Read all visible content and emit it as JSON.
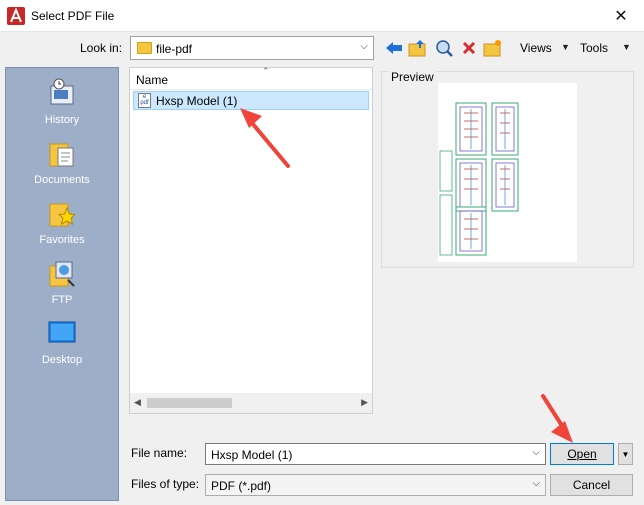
{
  "window": {
    "title": "Select PDF File",
    "close_glyph": "✕"
  },
  "lookin": {
    "label": "Look in:",
    "value": "file-pdf"
  },
  "toolbar": {
    "views_label": "Views",
    "tools_label": "Tools"
  },
  "places": [
    {
      "label": "History",
      "icon": "history-icon"
    },
    {
      "label": "Documents",
      "icon": "documents-icon"
    },
    {
      "label": "Favorites",
      "icon": "favorites-icon"
    },
    {
      "label": "FTP",
      "icon": "ftp-icon"
    },
    {
      "label": "Desktop",
      "icon": "desktop-icon"
    }
  ],
  "filelist": {
    "column_name": "Name",
    "files": [
      {
        "name": "Hxsp Model (1)",
        "icon": "pdf-file-icon"
      }
    ]
  },
  "preview": {
    "label": "Preview"
  },
  "filename": {
    "label": "File name:",
    "value": "Hxsp Model (1)"
  },
  "filetype": {
    "label": "Files of type:",
    "value": "PDF (*.pdf)"
  },
  "buttons": {
    "open": "Open",
    "cancel": "Cancel"
  },
  "colors": {
    "accent": "#0078d7",
    "places_bg": "#9daec8",
    "selection": "#cce8ff",
    "annotation_arrow": "#f0433a"
  }
}
